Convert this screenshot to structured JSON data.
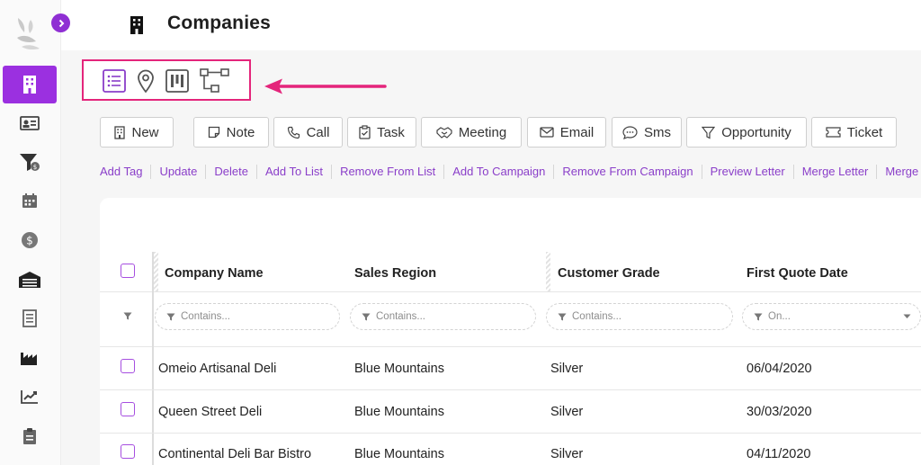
{
  "app": {
    "page_title": "Companies",
    "accent_color": "#9b30e0",
    "highlight_color": "#e4257b"
  },
  "sidebar": {
    "items": [
      {
        "icon": "building-icon",
        "active": true
      },
      {
        "icon": "contact-card-icon"
      },
      {
        "icon": "funnel-dollar-icon"
      },
      {
        "icon": "calendar-icon"
      },
      {
        "icon": "dollar-coin-icon"
      },
      {
        "icon": "warehouse-icon"
      },
      {
        "icon": "document-list-icon"
      },
      {
        "icon": "factory-icon"
      },
      {
        "icon": "trend-chart-icon"
      },
      {
        "icon": "clipboard-icon"
      }
    ]
  },
  "views": [
    {
      "icon": "list-view-icon",
      "active": true
    },
    {
      "icon": "map-pin-icon"
    },
    {
      "icon": "kanban-icon"
    },
    {
      "icon": "hierarchy-icon"
    }
  ],
  "toolbar": {
    "new_label": "New",
    "note_label": "Note",
    "call_label": "Call",
    "task_label": "Task",
    "meeting_label": "Meeting",
    "email_label": "Email",
    "sms_label": "Sms",
    "opportunity_label": "Opportunity",
    "ticket_label": "Ticket"
  },
  "actions": [
    "Add Tag",
    "Update",
    "Delete",
    "Add To List",
    "Remove From List",
    "Add To Campaign",
    "Remove From Campaign",
    "Preview Letter",
    "Merge Letter",
    "Merge Dupli"
  ],
  "grid": {
    "columns": [
      "Company Name",
      "Sales Region",
      "Customer Grade",
      "First Quote Date"
    ],
    "filters": {
      "contains": "Contains...",
      "on": "On..."
    },
    "rows": [
      {
        "name": "Omeio Artisanal Deli",
        "region": "Blue Mountains",
        "grade": "Silver",
        "date": "06/04/2020"
      },
      {
        "name": "Queen Street Deli",
        "region": "Blue Mountains",
        "grade": "Silver",
        "date": "30/03/2020"
      },
      {
        "name": "Continental Deli Bar Bistro",
        "region": "Blue Mountains",
        "grade": "Silver",
        "date": "04/11/2020"
      }
    ]
  }
}
